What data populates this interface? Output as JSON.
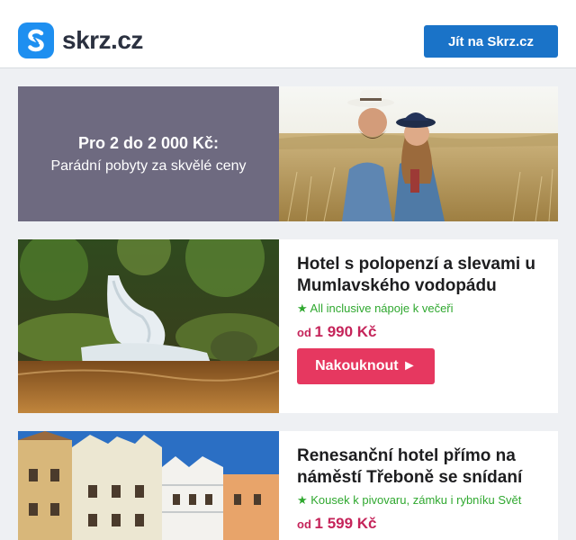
{
  "header": {
    "logo_text": "skrz.cz",
    "button_label": "Jít na Skrz.cz"
  },
  "banner": {
    "title": "Pro 2 do 2 000 Kč:",
    "subtitle": "Parádní pobyty za skvělé ceny"
  },
  "offers": [
    {
      "title": "Hotel s polopenzí a slevami u Mumlavského vodopádu",
      "perk": "★ All inclusive nápoje k večeři",
      "price_prefix": "od",
      "price": "1 990 Kč",
      "button_label": "Nakouknout ►"
    },
    {
      "title": "Renesanční hotel přímo na náměstí Třeboně se snídaní",
      "perk": "★ Kousek k pivovaru, zámku i rybníku Svět",
      "price_prefix": "od",
      "price": "1 599 Kč"
    }
  ],
  "colors": {
    "brand_blue": "#1a73c8",
    "logo_blue": "#1e8ff0",
    "cta_pink": "#e63860",
    "price_pink": "#c5245a",
    "perk_green": "#2fa82f",
    "banner_panel": "#6e6a80"
  }
}
